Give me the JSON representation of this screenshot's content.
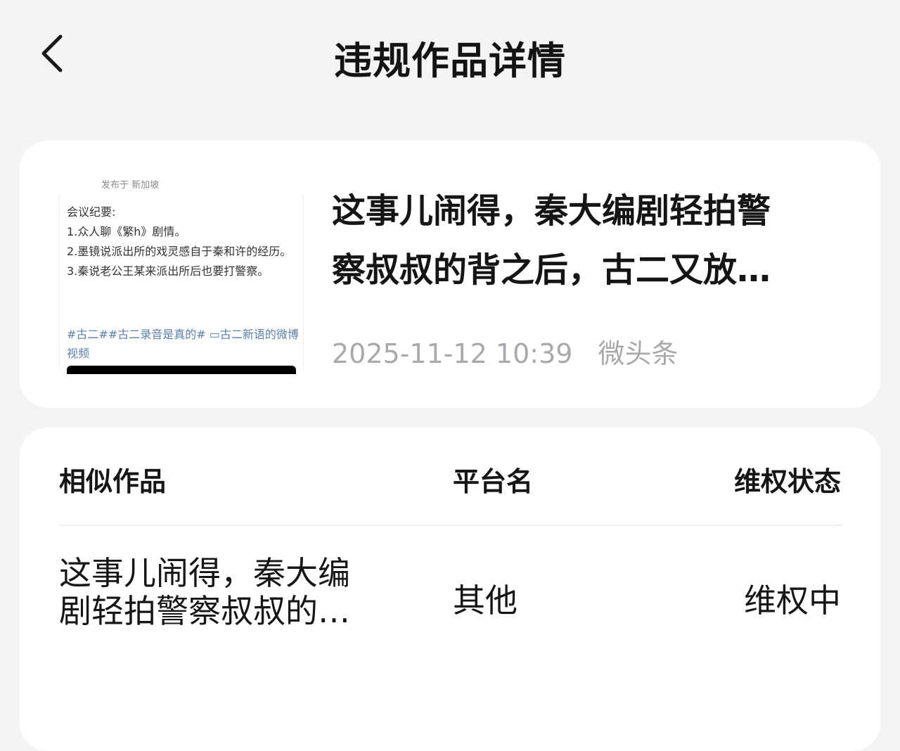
{
  "header": {
    "title": "违规作品详情",
    "back_icon": "chevron-left-icon"
  },
  "work": {
    "thumbnail": {
      "location": "发布于 新加坡",
      "lines": [
        "会议纪要:",
        "1.众人聊《繁h》剧情。",
        "2.墨镜说派出所的戏灵感自于秦和许的经历。",
        "3.秦说老公王某来派出所后也要打警察。"
      ],
      "tags": "#古二##古二录音是真的# ▭古二新语的微博视频"
    },
    "title_line1": "这事儿闹得，秦大编剧轻拍警",
    "title_line2": "察叔叔的背之后，古二又放…",
    "datetime": "2025-11-12 10:39",
    "platform": "微头条"
  },
  "similar": {
    "headers": {
      "work": "相似作品",
      "platform": "平台名",
      "status": "维权状态"
    },
    "rows": [
      {
        "title_line1": "这事儿闹得，秦大编",
        "title_line2": "剧轻拍警察叔叔的…",
        "platform": "其他",
        "status": "维权中"
      }
    ]
  }
}
